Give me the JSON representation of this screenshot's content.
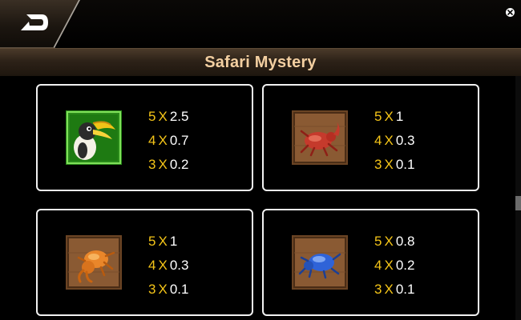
{
  "header": {
    "back_icon": "back-arrow-icon",
    "close_icon": "close-icon"
  },
  "title": "Safari Mystery",
  "separator": "X",
  "colors": {
    "title": "#f3cfa1",
    "count": "#f5c518",
    "multiplier": "#ffffff",
    "card_border": "#f2f2f2"
  },
  "symbols": [
    {
      "icon": "hornbill-bird-icon",
      "pays": [
        {
          "count": "5",
          "mult": "2.5"
        },
        {
          "count": "4",
          "mult": "0.7"
        },
        {
          "count": "3",
          "mult": "0.2"
        }
      ]
    },
    {
      "icon": "red-rhino-beetle-icon",
      "pays": [
        {
          "count": "5",
          "mult": "1"
        },
        {
          "count": "4",
          "mult": "0.3"
        },
        {
          "count": "3",
          "mult": "0.1"
        }
      ]
    },
    {
      "icon": "orange-scorpion-beetle-icon",
      "pays": [
        {
          "count": "5",
          "mult": "1"
        },
        {
          "count": "4",
          "mult": "0.3"
        },
        {
          "count": "3",
          "mult": "0.1"
        }
      ]
    },
    {
      "icon": "blue-beetle-icon",
      "pays": [
        {
          "count": "5",
          "mult": "0.8"
        },
        {
          "count": "4",
          "mult": "0.2"
        },
        {
          "count": "3",
          "mult": "0.1"
        }
      ]
    }
  ]
}
